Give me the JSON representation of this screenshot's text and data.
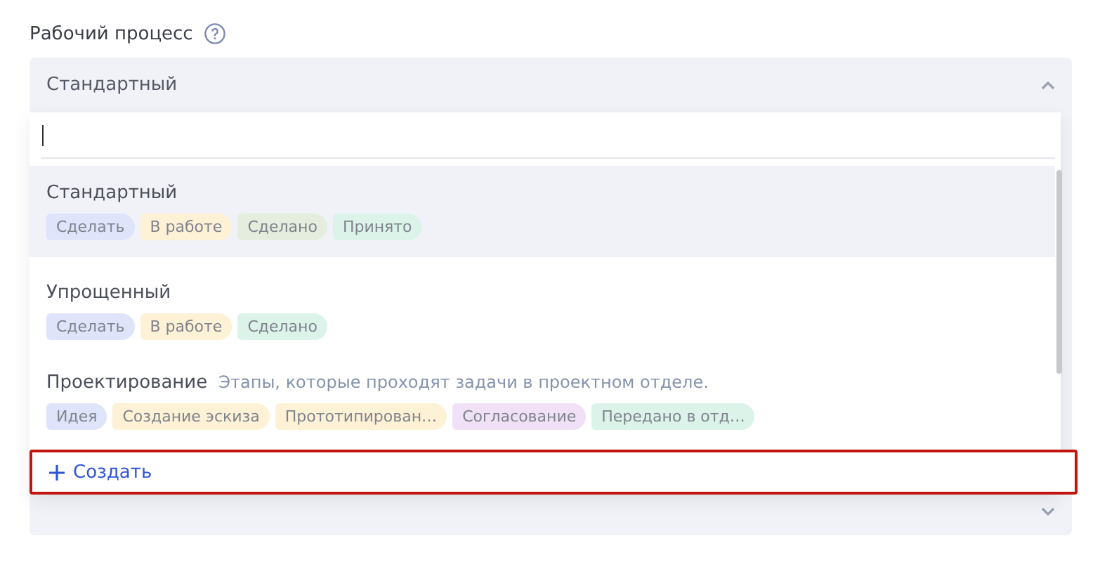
{
  "field_label": "Рабочий процесс",
  "select": {
    "value": "Стандартный",
    "expanded": true
  },
  "options": [
    {
      "name": "Стандартный",
      "selected": true,
      "tags": [
        {
          "label": "Сделать",
          "color": "#e0e4fb"
        },
        {
          "label": "В работе",
          "color": "#fdf1d6"
        },
        {
          "label": "Сделано",
          "color": "#e5eddf"
        },
        {
          "label": "Принято",
          "color": "#dbf3e9"
        }
      ]
    },
    {
      "name": "Упрощенный",
      "selected": false,
      "tags": [
        {
          "label": "Сделать",
          "color": "#e0e4fb"
        },
        {
          "label": "В работе",
          "color": "#fdf1d6"
        },
        {
          "label": "Сделано",
          "color": "#dbf3e9"
        }
      ]
    },
    {
      "name": "Проектирование",
      "description": "Этапы, которые проходят задачи в проектном отделе.",
      "selected": false,
      "tags": [
        {
          "label": "Идея",
          "color": "#e0e4fb"
        },
        {
          "label": "Создание эскиза",
          "color": "#fdf1d6"
        },
        {
          "label": "Прототипирован…",
          "color": "#fdf1d6"
        },
        {
          "label": "Согласование",
          "color": "#f0e1f6"
        },
        {
          "label": "Передано в отд…",
          "color": "#dbf3e9"
        }
      ]
    }
  ],
  "create_label": "Создать"
}
